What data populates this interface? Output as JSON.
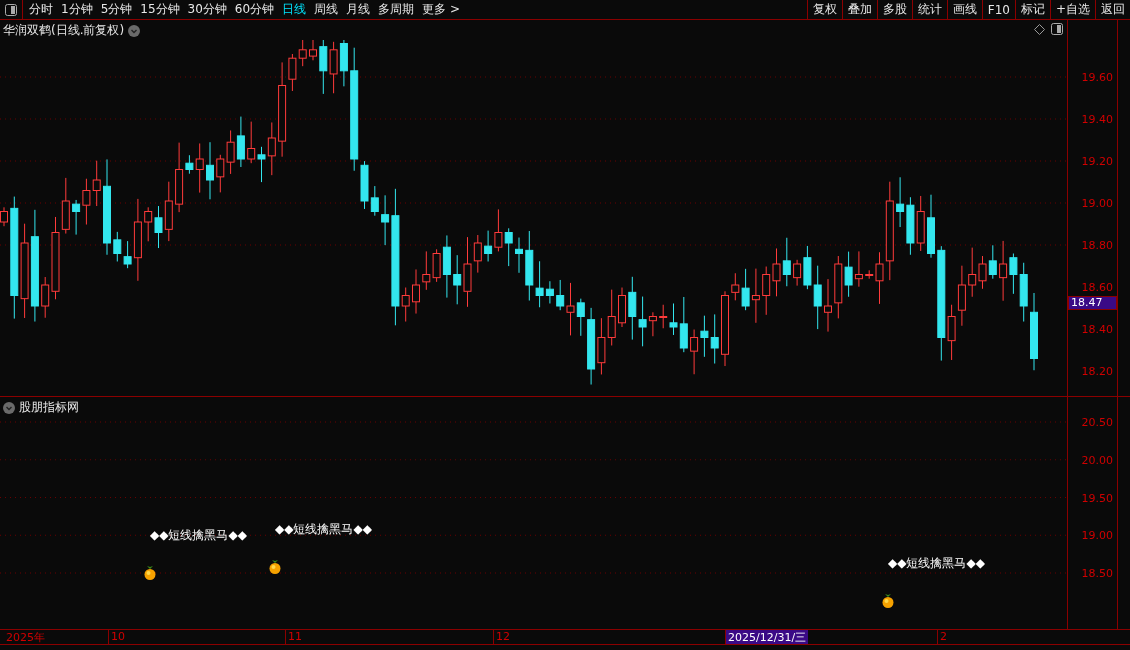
{
  "toolbar": {
    "periods": [
      {
        "label": "分时",
        "selected": false
      },
      {
        "label": "1分钟",
        "selected": false
      },
      {
        "label": "5分钟",
        "selected": false
      },
      {
        "label": "15分钟",
        "selected": false
      },
      {
        "label": "30分钟",
        "selected": false
      },
      {
        "label": "60分钟",
        "selected": false
      },
      {
        "label": "日线",
        "selected": true
      },
      {
        "label": "周线",
        "selected": false
      },
      {
        "label": "月线",
        "selected": false
      },
      {
        "label": "多周期",
        "selected": false
      },
      {
        "label": "更多 >",
        "selected": false
      }
    ],
    "actions": [
      "复权",
      "叠加",
      "多股",
      "统计",
      "画线",
      "F10",
      "标记",
      "+自选",
      "返回"
    ]
  },
  "main_chart": {
    "title": "华润双鹤(日线.前复权)",
    "y_axis": [
      "19.60",
      "19.40",
      "19.20",
      "19.00",
      "18.80",
      "18.60",
      "18.40",
      "18.20"
    ],
    "last_price": "18.47"
  },
  "indicator": {
    "title": "股朋指标网",
    "y_axis": [
      "20.50",
      "20.00",
      "19.50",
      "19.00",
      "18.50"
    ],
    "signals": [
      {
        "label": "◆◆短线擒黑马◆◆"
      },
      {
        "label": "◆◆短线擒黑马◆◆"
      },
      {
        "label": "◆◆短线擒黑马◆◆"
      }
    ]
  },
  "date_axis": {
    "labels": [
      {
        "text": "2025年",
        "kind": "year"
      },
      {
        "text": "10",
        "kind": "month"
      },
      {
        "text": "11",
        "kind": "month"
      },
      {
        "text": "12",
        "kind": "month"
      },
      {
        "text": "2025/12/31/三",
        "kind": "cursor"
      },
      {
        "text": "2",
        "kind": "month"
      }
    ]
  }
}
